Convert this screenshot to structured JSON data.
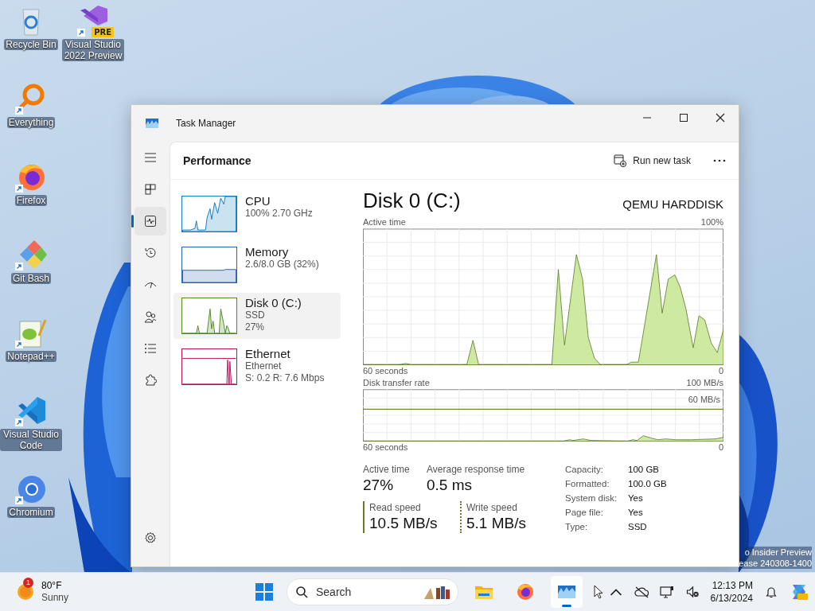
{
  "desktop_icons": [
    {
      "label": "Recycle Bin",
      "kind": "recycle",
      "shortcut": false
    },
    {
      "label": "Everything",
      "kind": "everything",
      "shortcut": true
    },
    {
      "label": "Firefox",
      "kind": "firefox",
      "shortcut": true
    },
    {
      "label": "Git Bash",
      "kind": "gitbash",
      "shortcut": true
    },
    {
      "label": "Notepad++",
      "kind": "notepadpp",
      "shortcut": true
    },
    {
      "label": "Visual Studio Code",
      "kind": "vscode",
      "shortcut": true
    },
    {
      "label": "Chromium",
      "kind": "chromium",
      "shortcut": true
    },
    {
      "label": "Visual Studio 2022 Preview",
      "kind": "vspreview",
      "shortcut": true,
      "badge": "PRE"
    }
  ],
  "desktop_build_info": [
    "o Insider Preview",
    "ease 240308-1400"
  ],
  "window": {
    "title": "Task Manager"
  },
  "nav_items": [
    {
      "kind": "processes",
      "selected": false
    },
    {
      "kind": "performance",
      "selected": true
    },
    {
      "kind": "history",
      "selected": false
    },
    {
      "kind": "startup",
      "selected": false
    },
    {
      "kind": "users",
      "selected": false
    },
    {
      "kind": "details",
      "selected": false
    },
    {
      "kind": "services",
      "selected": false
    }
  ],
  "header": {
    "title": "Performance",
    "action": "Run new task"
  },
  "devices": [
    {
      "name": "CPU",
      "kind": "cpu",
      "color": "#117dbb",
      "selected": false,
      "lines": [
        "100% 2.70 GHz"
      ]
    },
    {
      "name": "Memory",
      "kind": "memory",
      "color": "#2a62b0",
      "selected": false,
      "lines": [
        "2.6/8.0 GB (32%)"
      ]
    },
    {
      "name": "Disk 0 (C:)",
      "kind": "disk",
      "color": "#4d8a1c",
      "selected": true,
      "lines": [
        "SSD",
        "27%"
      ]
    },
    {
      "name": "Ethernet",
      "kind": "ethernet",
      "color": "#b8135a",
      "selected": false,
      "lines": [
        "Ethernet",
        "S: 0.2 R: 7.6 Mbps"
      ]
    }
  ],
  "detail": {
    "title": "Disk 0 (C:)",
    "model": "QEMU HARDDISK",
    "active_graph": {
      "label": "Active time",
      "max": "100%",
      "start": "60 seconds",
      "end": "0"
    },
    "transfer_graph": {
      "label": "Disk transfer rate",
      "max": "100 MB/s",
      "marker": "60 MB/s",
      "start": "60 seconds",
      "end": "0"
    },
    "stats": [
      {
        "label": "Active time",
        "value": "27%"
      },
      {
        "label": "Average response time",
        "value": "0.5 ms"
      }
    ],
    "speeds": [
      {
        "label": "Read speed",
        "value": "10.5 MB/s",
        "kind": "solid"
      },
      {
        "label": "Write speed",
        "value": "5.1 MB/s",
        "kind": "dotted"
      }
    ],
    "properties": [
      {
        "label": "Capacity:",
        "value": "100 GB"
      },
      {
        "label": "Formatted:",
        "value": "100.0 GB"
      },
      {
        "label": "System disk:",
        "value": "Yes"
      },
      {
        "label": "Page file:",
        "value": "Yes"
      },
      {
        "label": "Type:",
        "value": "SSD"
      }
    ]
  },
  "taskbar": {
    "weather": {
      "badge": "1",
      "temperature": "80°F",
      "condition": "Sunny"
    },
    "search": {
      "placeholder": "Search"
    },
    "apps": [
      {
        "kind": "explorer",
        "selected": false
      },
      {
        "kind": "firefox",
        "selected": false
      },
      {
        "kind": "taskmanager",
        "selected": true
      }
    ],
    "time": "12:13 PM",
    "date": "6/13/2024"
  }
}
